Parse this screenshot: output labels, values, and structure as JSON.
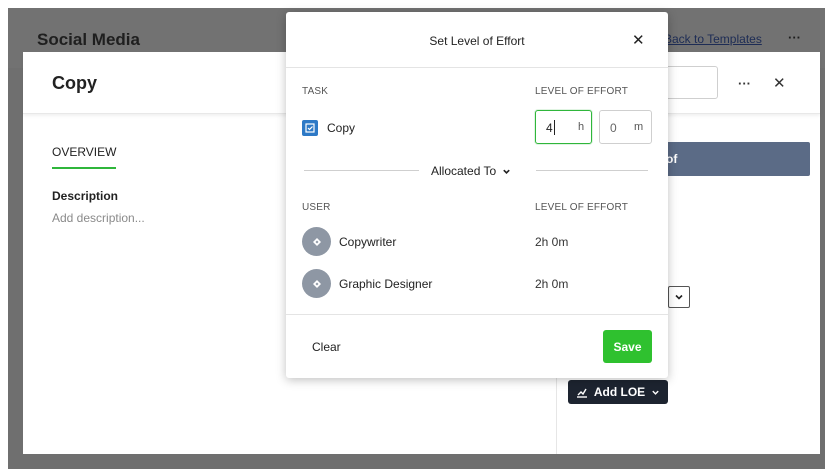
{
  "background": {
    "title": "Social Media",
    "back_link": "Back to Templates",
    "more": "···"
  },
  "task_panel": {
    "title": "Copy",
    "more": "···",
    "close": "✕",
    "tab_overview": "OVERVIEW",
    "description_label": "Description",
    "description_placeholder": "Add description...",
    "right_bar_text": "of",
    "add_loe_label": "Add LOE",
    "select_chevron": "⌄"
  },
  "modal": {
    "title": "Set Level of Effort",
    "close": "✕",
    "task_col_label": "TASK",
    "loe_col_label": "LEVEL OF EFFORT",
    "task": {
      "name": "Copy",
      "icon": "task-checkbox-icon",
      "hours_value": "4",
      "hours_unit": "h",
      "minutes_value": "0",
      "minutes_unit": "m"
    },
    "allocated_label": "Allocated To",
    "user_col_label": "USER",
    "user_loe_col_label": "LEVEL OF EFFORT",
    "users": [
      {
        "name": "Copywriter",
        "loe": "2h 0m"
      },
      {
        "name": "Graphic Designer",
        "loe": "2h 0m"
      }
    ],
    "clear_label": "Clear",
    "save_label": "Save"
  },
  "colors": {
    "accent_green": "#2fc12f",
    "task_icon_blue": "#2d79c6",
    "avatar_gray": "#8e97a4",
    "dark_button": "#1d2430"
  }
}
